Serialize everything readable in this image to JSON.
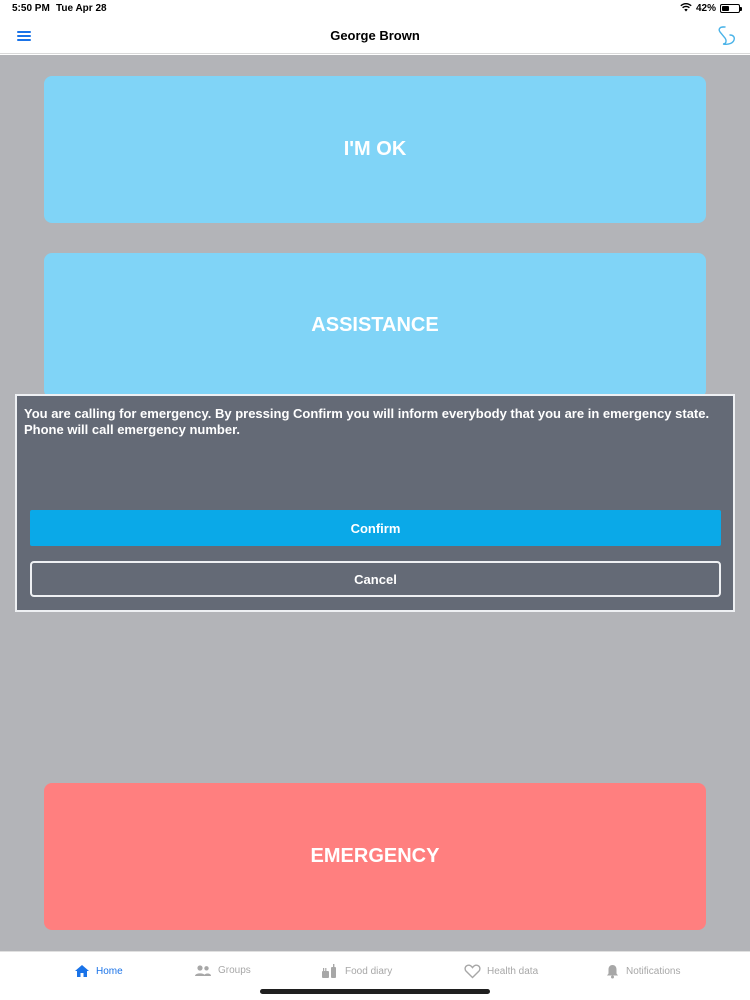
{
  "status_bar": {
    "time": "5:50 PM",
    "date": "Tue Apr 28",
    "battery_label": "42%",
    "battery_level": 0.42,
    "icons": [
      "wifi-icon",
      "battery-icon"
    ]
  },
  "nav": {
    "title": "George Brown",
    "menu_icon": "hamburger-menu-icon",
    "logo_icon": "app-logo-icon"
  },
  "main": {
    "ok_label": "I'M OK",
    "assistance_label": "ASSISTANCE",
    "emergency_label": "EMERGENCY"
  },
  "dialog": {
    "message": "You are calling for emergency. By pressing Confirm you will inform everybody that you are in emergency state. Phone will call emergency number.",
    "confirm_label": "Confirm",
    "cancel_label": "Cancel"
  },
  "tabs": [
    {
      "label": "Home",
      "icon": "home-icon",
      "active": true
    },
    {
      "label": "Groups",
      "icon": "groups-icon",
      "active": false
    },
    {
      "label": "Food diary",
      "icon": "food-diary-icon",
      "active": false
    },
    {
      "label": "Health data",
      "icon": "heart-icon",
      "active": false
    },
    {
      "label": "Notifications",
      "icon": "bell-icon",
      "active": false
    }
  ],
  "colors": {
    "ok_button": "#80d4f7",
    "assistance_button": "#80d4f7",
    "emergency_button": "#ff7f7f",
    "confirm_button": "#0aa9e8",
    "overlay_background": "#b3b4b8",
    "dialog_background": "#646a76",
    "active_tab": "#1a73e8",
    "inactive_tab": "#a7a7a7"
  }
}
